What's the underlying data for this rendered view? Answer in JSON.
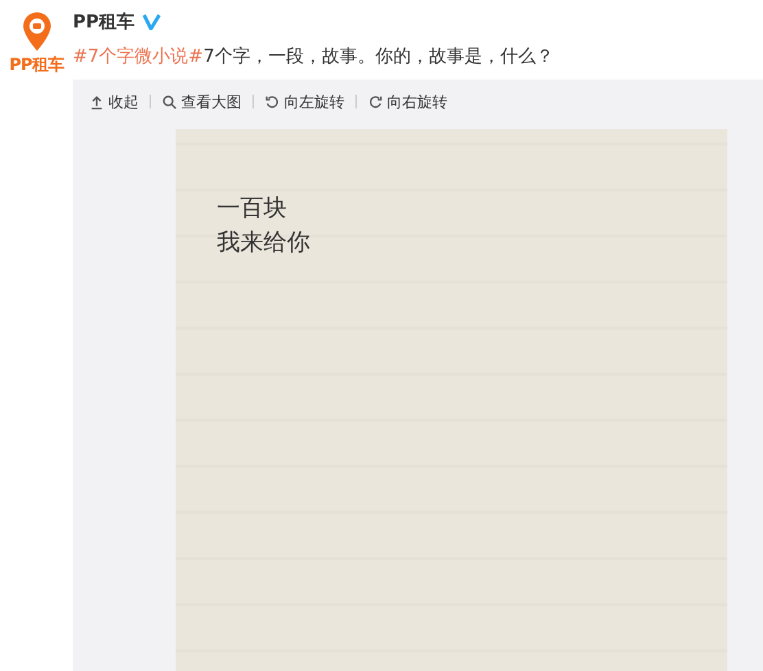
{
  "avatar": {
    "logo_text": "PP租车"
  },
  "author": {
    "name": "PP租车",
    "verified": true
  },
  "post": {
    "topic": "#7个字微小说#",
    "text": "7个字，一段，故事。你的，故事是，什么？"
  },
  "toolbar": [
    {
      "kind": "collapse",
      "label": "收起"
    },
    {
      "kind": "zoom",
      "label": "查看大图"
    },
    {
      "kind": "rotate-left",
      "label": "向左旋转"
    },
    {
      "kind": "rotate-right",
      "label": "向右旋转"
    }
  ],
  "image": {
    "lines": [
      "一百块",
      "我来给你"
    ]
  }
}
